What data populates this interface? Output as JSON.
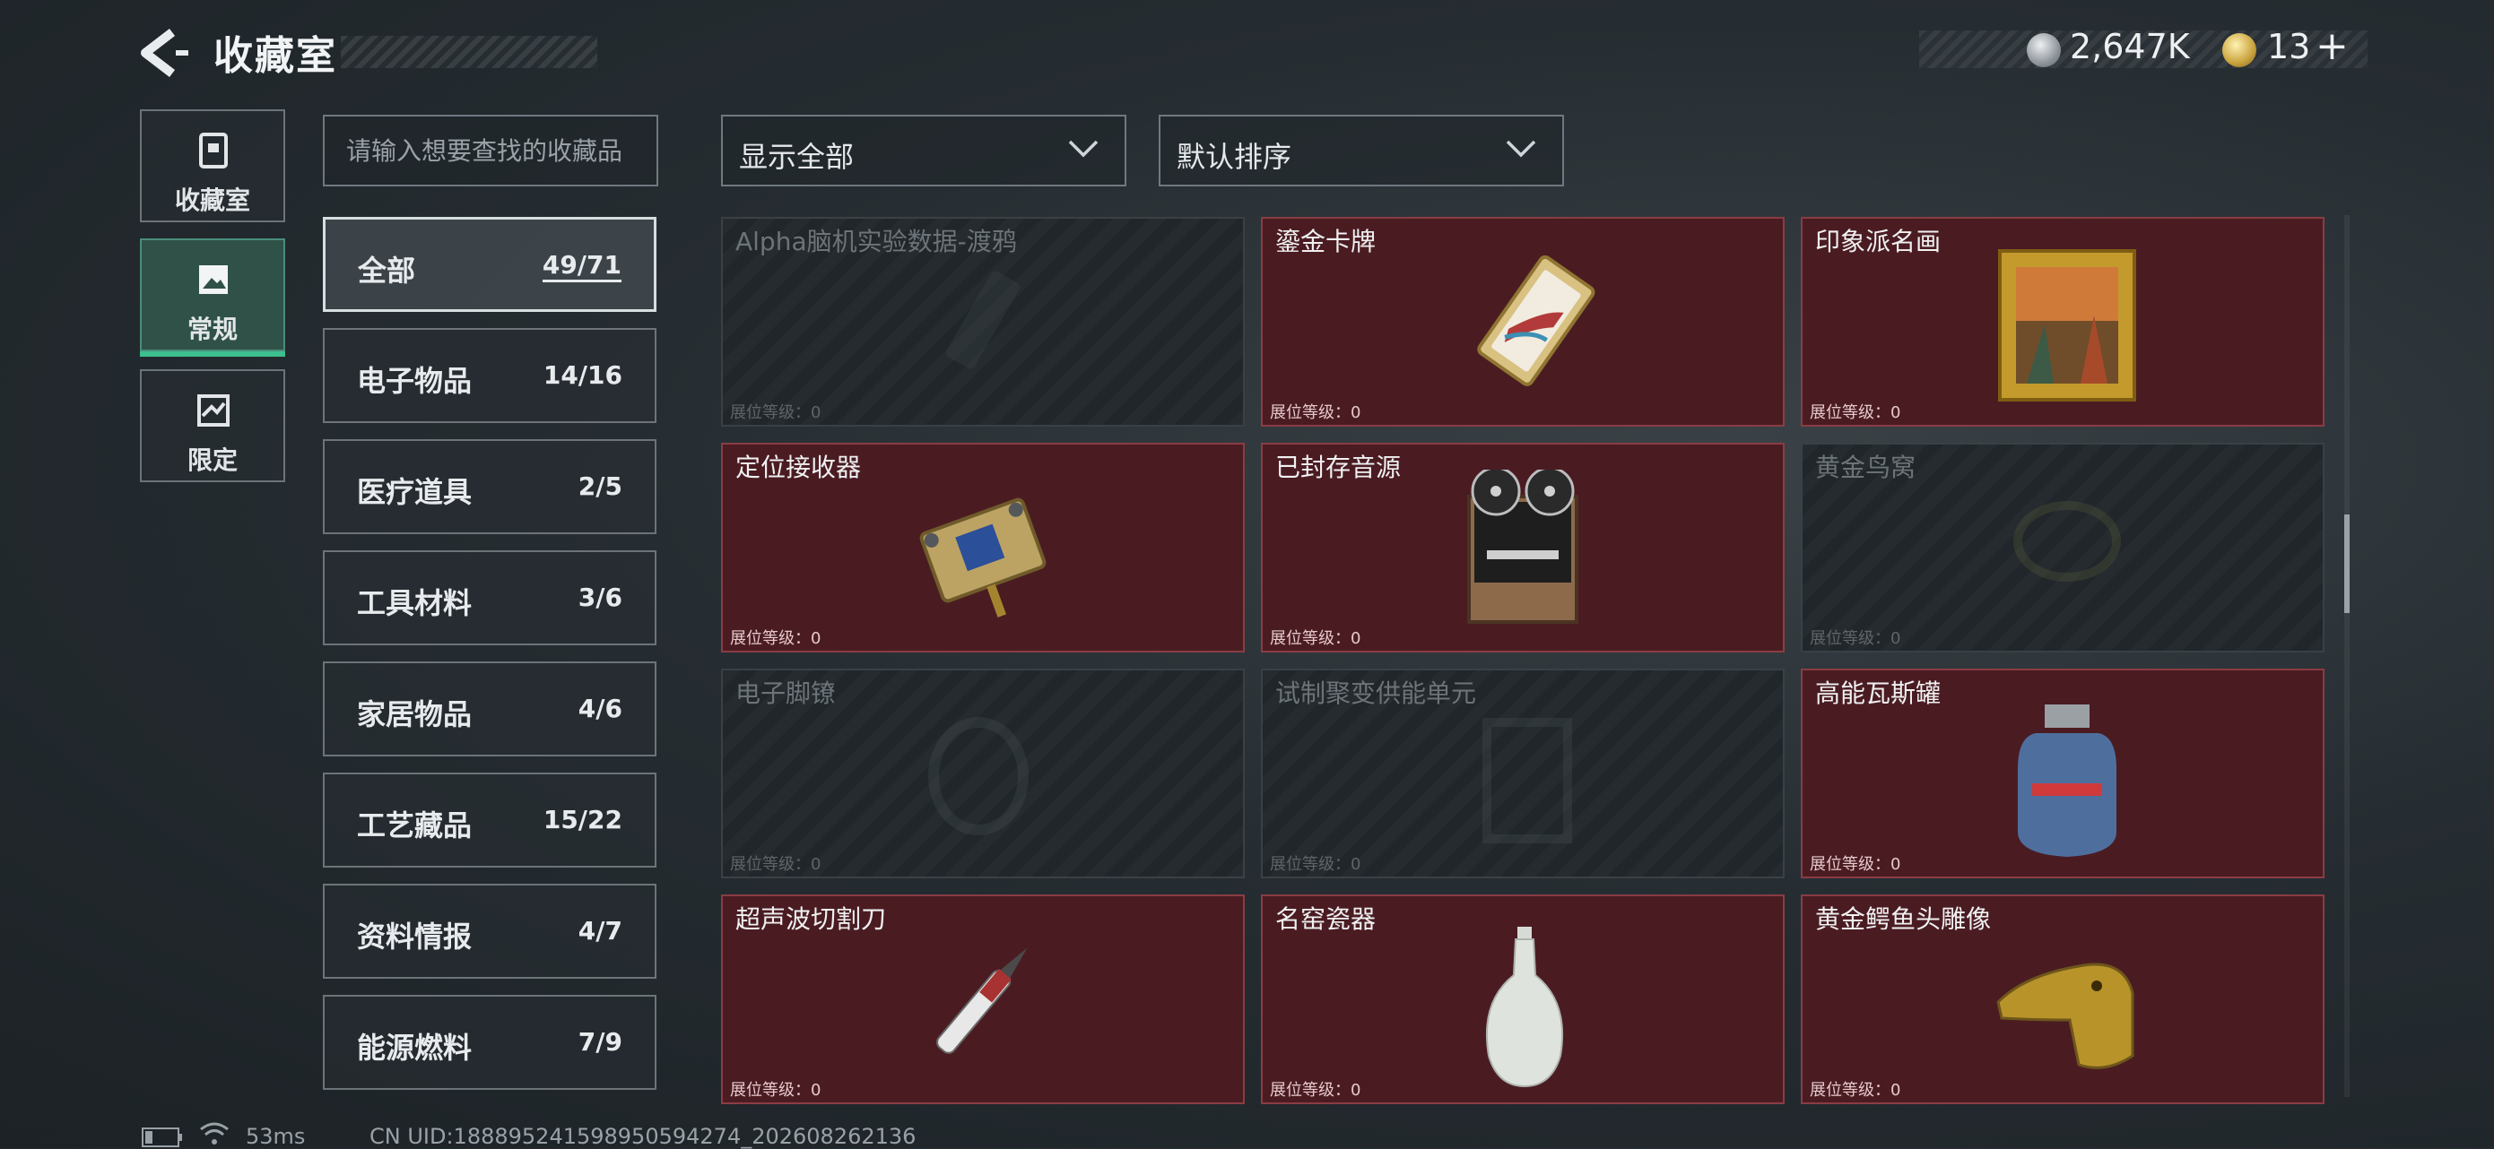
{
  "header": {
    "title": "收藏室",
    "silver_amount": "2,647K",
    "gold_amount": "13",
    "gold_plus": "+"
  },
  "nav": {
    "tabs": [
      {
        "label": "收藏室",
        "icon": "collection-icon",
        "active": false
      },
      {
        "label": "常规",
        "icon": "picture-icon",
        "active": true
      },
      {
        "label": "限定",
        "icon": "limited-icon",
        "active": false
      }
    ]
  },
  "search": {
    "placeholder": "请输入想要查找的收藏品",
    "value": ""
  },
  "filters": {
    "display": "显示全部",
    "sort": "默认排序"
  },
  "categories": [
    {
      "name": "全部",
      "count": "49/71",
      "active": true
    },
    {
      "name": "电子物品",
      "count": "14/16"
    },
    {
      "name": "医疗道具",
      "count": "2/5"
    },
    {
      "name": "工具材料",
      "count": "3/6"
    },
    {
      "name": "家居物品",
      "count": "4/6"
    },
    {
      "name": "工艺藏品",
      "count": "15/22"
    },
    {
      "name": "资料情报",
      "count": "4/7"
    },
    {
      "name": "能源燃料",
      "count": "7/9"
    }
  ],
  "items": [
    {
      "name": "Alpha脑机实验数据-渡鸦",
      "level": "展位等级：0",
      "owned": false,
      "icon": "data-drive-icon"
    },
    {
      "name": "鎏金卡牌",
      "level": "展位等级：0",
      "owned": true,
      "icon": "gilded-card-icon"
    },
    {
      "name": "印象派名画",
      "level": "展位等级：0",
      "owned": true,
      "icon": "painting-icon"
    },
    {
      "name": "定位接收器",
      "level": "展位等级：0",
      "owned": true,
      "icon": "receiver-icon"
    },
    {
      "name": "已封存音源",
      "level": "展位等级：0",
      "owned": true,
      "icon": "tape-recorder-icon"
    },
    {
      "name": "黄金鸟窝",
      "level": "展位等级：0",
      "owned": false,
      "icon": "bird-nest-icon"
    },
    {
      "name": "电子脚镣",
      "level": "展位等级：0",
      "owned": false,
      "icon": "ankle-monitor-icon"
    },
    {
      "name": "试制聚变供能单元",
      "level": "展位等级：0",
      "owned": false,
      "icon": "fusion-cell-icon"
    },
    {
      "name": "高能瓦斯罐",
      "level": "展位等级：0",
      "owned": true,
      "icon": "gas-canister-icon"
    },
    {
      "name": "超声波切割刀",
      "level": "展位等级：0",
      "owned": true,
      "icon": "ultrasonic-knife-icon"
    },
    {
      "name": "名窑瓷器",
      "level": "展位等级：0",
      "owned": true,
      "icon": "porcelain-vase-icon"
    },
    {
      "name": "黄金鳄鱼头雕像",
      "level": "展位等级：0",
      "owned": true,
      "icon": "crocodile-statue-icon"
    }
  ],
  "footer": {
    "ping": "53ms",
    "uid": "CN UID:18889524159895059427‍4_202608262136"
  }
}
